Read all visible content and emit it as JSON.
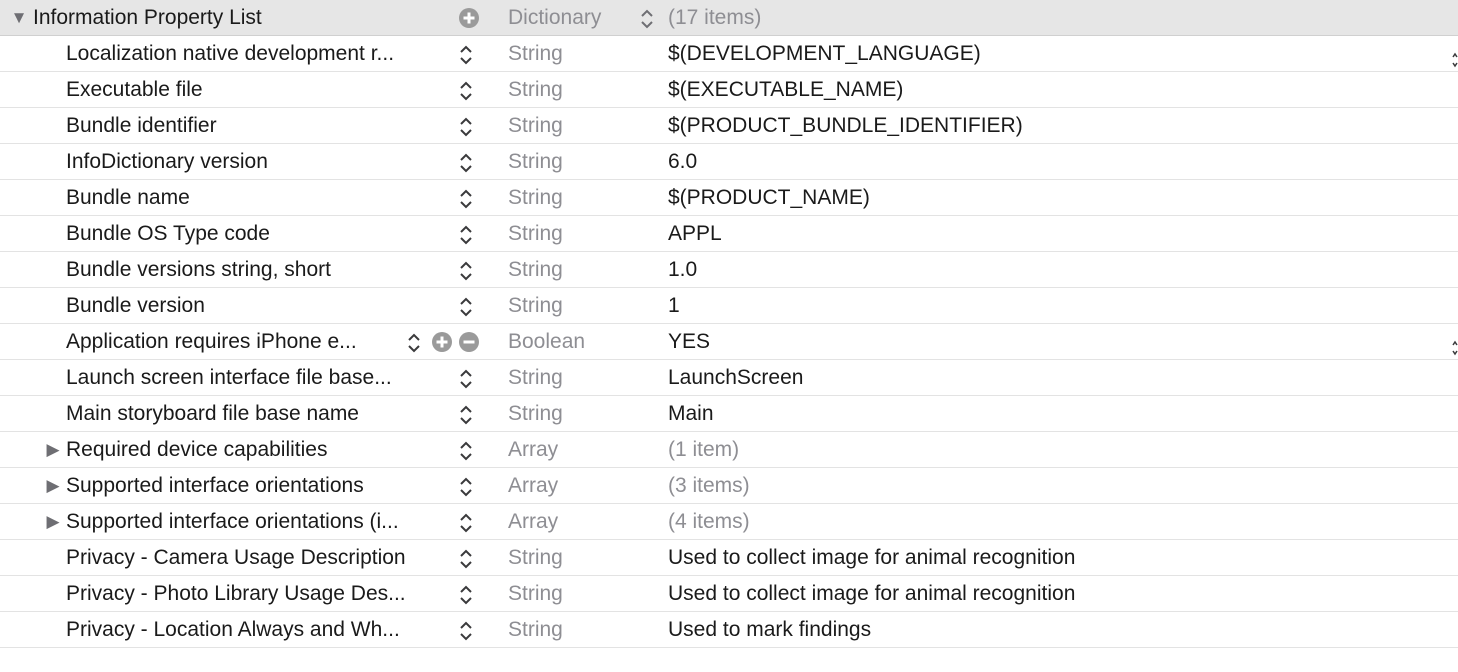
{
  "root": {
    "key": "Information Property List",
    "type": "Dictionary",
    "value": "(17 items)",
    "expanded": true
  },
  "rows": [
    {
      "key": "Localization native development r...",
      "type": "String",
      "value": "$(DEVELOPMENT_LANGUAGE)",
      "hasChildren": false,
      "dimValue": false,
      "edgeMarker": true
    },
    {
      "key": "Executable file",
      "type": "String",
      "value": "$(EXECUTABLE_NAME)",
      "hasChildren": false,
      "dimValue": false
    },
    {
      "key": "Bundle identifier",
      "type": "String",
      "value": "$(PRODUCT_BUNDLE_IDENTIFIER)",
      "hasChildren": false,
      "dimValue": false
    },
    {
      "key": "InfoDictionary version",
      "type": "String",
      "value": "6.0",
      "hasChildren": false,
      "dimValue": false
    },
    {
      "key": "Bundle name",
      "type": "String",
      "value": "$(PRODUCT_NAME)",
      "hasChildren": false,
      "dimValue": false
    },
    {
      "key": "Bundle OS Type code",
      "type": "String",
      "value": "APPL",
      "hasChildren": false,
      "dimValue": false
    },
    {
      "key": "Bundle versions string, short",
      "type": "String",
      "value": "1.0",
      "hasChildren": false,
      "dimValue": false
    },
    {
      "key": "Bundle version",
      "type": "String",
      "value": "1",
      "hasChildren": false,
      "dimValue": false
    },
    {
      "key": "Application requires iPhone e...",
      "type": "Boolean",
      "value": "YES",
      "hasChildren": false,
      "dimValue": false,
      "hovered": true,
      "edgeMarker": true
    },
    {
      "key": "Launch screen interface file base...",
      "type": "String",
      "value": "LaunchScreen",
      "hasChildren": false,
      "dimValue": false
    },
    {
      "key": "Main storyboard file base name",
      "type": "String",
      "value": "Main",
      "hasChildren": false,
      "dimValue": false
    },
    {
      "key": "Required device capabilities",
      "type": "Array",
      "value": "(1 item)",
      "hasChildren": true,
      "dimValue": true
    },
    {
      "key": "Supported interface orientations",
      "type": "Array",
      "value": "(3 items)",
      "hasChildren": true,
      "dimValue": true
    },
    {
      "key": "Supported interface orientations (i...",
      "type": "Array",
      "value": "(4 items)",
      "hasChildren": true,
      "dimValue": true
    },
    {
      "key": "Privacy - Camera Usage Description",
      "type": "String",
      "value": "Used to collect image for animal recognition",
      "hasChildren": false,
      "dimValue": false
    },
    {
      "key": "Privacy - Photo Library Usage Des...",
      "type": "String",
      "value": "Used to collect image for animal recognition",
      "hasChildren": false,
      "dimValue": false
    },
    {
      "key": "Privacy - Location Always and Wh...",
      "type": "String",
      "value": "Used to mark findings",
      "hasChildren": false,
      "dimValue": false
    }
  ],
  "icons": {
    "disclosure_expanded": "triangle-down-icon",
    "disclosure_collapsed": "triangle-right-icon",
    "stepper": "up-down-chevron-icon",
    "add": "plus-circle-icon",
    "remove": "minus-circle-icon"
  },
  "colors": {
    "root_background": "#e6e6e6",
    "row_divider": "#e3e3e3",
    "secondary_text": "#8e8e93",
    "primary_text": "#1a1a1a",
    "control_gray": "#9a9a9a"
  }
}
